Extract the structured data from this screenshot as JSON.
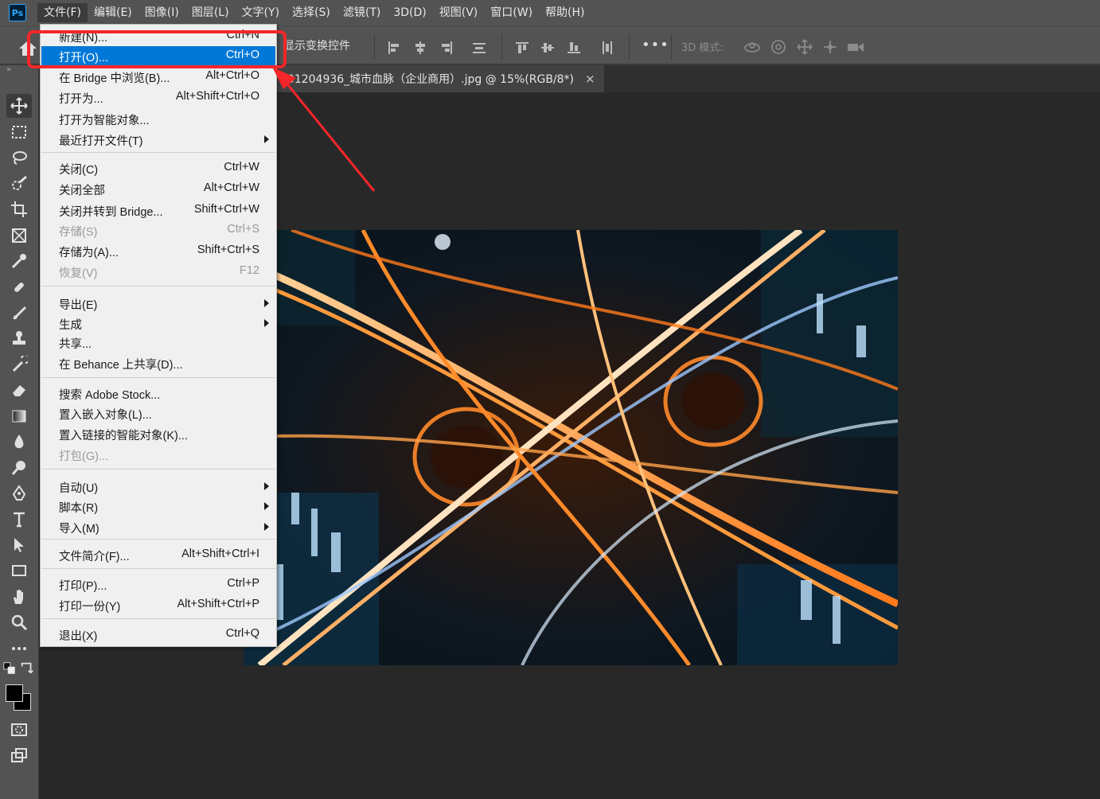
{
  "app": {
    "logo_text": "Ps"
  },
  "menubar": {
    "items": [
      "文件(F)",
      "编辑(E)",
      "图像(I)",
      "图层(L)",
      "文字(Y)",
      "选择(S)",
      "滤镜(T)",
      "3D(D)",
      "视图(V)",
      "窗口(W)",
      "帮助(H)"
    ]
  },
  "options_bar": {
    "show_transform_controls": "显示变换控件",
    "more": "•••",
    "mode_3d_label": "3D 模式:"
  },
  "document": {
    "tab_title": "501204936_城市血脉（企业商用）.jpg @ 15%(RGB/8*)",
    "close": "×"
  },
  "file_menu": {
    "items": [
      {
        "label": "新建(N)...",
        "shortcut": "Ctrl+N",
        "state": "normal"
      },
      {
        "label": "打开(O)...",
        "shortcut": "Ctrl+O",
        "state": "highlighted"
      },
      {
        "label": "在 Bridge 中浏览(B)...",
        "shortcut": "Alt+Ctrl+O",
        "state": "normal"
      },
      {
        "label": "打开为...",
        "shortcut": "Alt+Shift+Ctrl+O",
        "state": "normal"
      },
      {
        "label": "打开为智能对象...",
        "shortcut": "",
        "state": "normal"
      },
      {
        "label": "最近打开文件(T)",
        "shortcut": "",
        "state": "submenu"
      },
      {
        "label": "关闭(C)",
        "shortcut": "Ctrl+W",
        "state": "normal"
      },
      {
        "label": "关闭全部",
        "shortcut": "Alt+Ctrl+W",
        "state": "normal"
      },
      {
        "label": "关闭并转到 Bridge...",
        "shortcut": "Shift+Ctrl+W",
        "state": "normal"
      },
      {
        "label": "存储(S)",
        "shortcut": "Ctrl+S",
        "state": "disabled"
      },
      {
        "label": "存储为(A)...",
        "shortcut": "Shift+Ctrl+S",
        "state": "normal"
      },
      {
        "label": "恢复(V)",
        "shortcut": "F12",
        "state": "disabled"
      },
      {
        "label": "导出(E)",
        "shortcut": "",
        "state": "submenu"
      },
      {
        "label": "生成",
        "shortcut": "",
        "state": "submenu"
      },
      {
        "label": "共享...",
        "shortcut": "",
        "state": "normal"
      },
      {
        "label": "在 Behance 上共享(D)...",
        "shortcut": "",
        "state": "normal"
      },
      {
        "label": "搜索 Adobe Stock...",
        "shortcut": "",
        "state": "normal"
      },
      {
        "label": "置入嵌入对象(L)...",
        "shortcut": "",
        "state": "normal"
      },
      {
        "label": "置入链接的智能对象(K)...",
        "shortcut": "",
        "state": "normal"
      },
      {
        "label": "打包(G)...",
        "shortcut": "",
        "state": "disabled"
      },
      {
        "label": "自动(U)",
        "shortcut": "",
        "state": "submenu"
      },
      {
        "label": "脚本(R)",
        "shortcut": "",
        "state": "submenu"
      },
      {
        "label": "导入(M)",
        "shortcut": "",
        "state": "submenu"
      },
      {
        "label": "文件简介(F)...",
        "shortcut": "Alt+Shift+Ctrl+I",
        "state": "normal"
      },
      {
        "label": "打印(P)...",
        "shortcut": "Ctrl+P",
        "state": "normal"
      },
      {
        "label": "打印一份(Y)",
        "shortcut": "Alt+Shift+Ctrl+P",
        "state": "normal"
      },
      {
        "label": "退出(X)",
        "shortcut": "Ctrl+Q",
        "state": "normal"
      }
    ]
  },
  "toolbar": {
    "collapse": "»",
    "tools": [
      "move-tool",
      "marquee-tool",
      "lasso-tool",
      "quick-select-tool",
      "crop-tool",
      "frame-tool",
      "eyedropper-tool",
      "healing-tool",
      "brush-tool",
      "stamp-tool",
      "history-brush-tool",
      "eraser-tool",
      "gradient-tool",
      "blur-tool",
      "dodge-tool",
      "pen-tool",
      "type-tool",
      "path-select-tool",
      "rectangle-tool",
      "hand-tool",
      "zoom-tool",
      "more-tools"
    ]
  },
  "colors": {
    "ui_bg": "#535353",
    "canvas_bg": "#282828",
    "menu_bg": "#f0f0f0",
    "menu_highlight": "#0078d7",
    "annotation_red": "#f4262a"
  }
}
